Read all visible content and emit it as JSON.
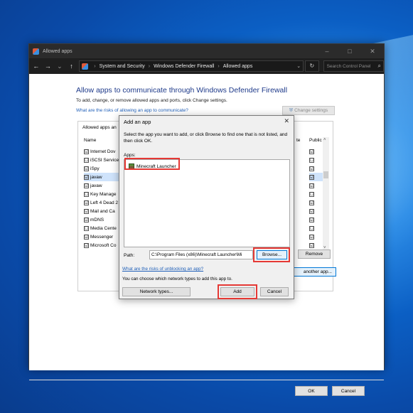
{
  "window": {
    "title": "Allowed apps",
    "controls": {
      "minimize": "–",
      "maximize": "□",
      "close": "✕"
    }
  },
  "navbar": {
    "back": "←",
    "forward": "→",
    "up": "↑",
    "breadcrumb": [
      "System and Security",
      "Windows Defender Firewall",
      "Allowed apps"
    ],
    "breadcrumb_separator": "›",
    "dropdown": "⌄",
    "refresh": "↻",
    "search_placeholder": "Search Control Panel",
    "search_icon": "⌕"
  },
  "main": {
    "heading": "Allow apps to communicate through Windows Defender Firewall",
    "subtext": "To add, change, or remove allowed apps and ports, click Change settings.",
    "risk_link": "What are the risks of allowing an app to communicate?",
    "change_settings": "Change settings",
    "allowed_label": "Allowed apps an",
    "name_header": "Name",
    "private_header": "te",
    "public_header": "Public",
    "apps": [
      {
        "name": "Internet Dov",
        "checked": "☑",
        "public": "☑",
        "selected": false
      },
      {
        "name": "iSCSI Service",
        "checked": "☐",
        "public": "☐",
        "selected": false
      },
      {
        "name": "iSpy",
        "checked": "☑",
        "public": "☑",
        "selected": false
      },
      {
        "name": "javaw",
        "checked": "☑",
        "public": "☑",
        "selected": true
      },
      {
        "name": "javaw",
        "checked": "☑",
        "public": "☑",
        "selected": false
      },
      {
        "name": "Key Manage",
        "checked": "☐",
        "public": "☐",
        "selected": false
      },
      {
        "name": "Left 4 Dead 2",
        "checked": "☑",
        "public": "☑",
        "selected": false
      },
      {
        "name": "Mail and Ca",
        "checked": "☑",
        "public": "☑",
        "selected": false
      },
      {
        "name": "mDNS",
        "checked": "☑",
        "public": "☑",
        "selected": false
      },
      {
        "name": "Media Cente",
        "checked": "☐",
        "public": "☐",
        "selected": false
      },
      {
        "name": "Messenger",
        "checked": "☑",
        "public": "☑",
        "selected": false
      },
      {
        "name": "Microsoft Co",
        "checked": "☑",
        "public": "☑",
        "selected": false
      }
    ],
    "remove_button": "Remove",
    "another_app_button": "another app...",
    "ok_button": "OK",
    "cancel_button": "Cancel"
  },
  "dialog": {
    "title": "Add an app",
    "close": "✕",
    "instructions": "Select the app you want to add, or click Browse to find one that is not listed, and then click OK.",
    "apps_label": "Apps:",
    "selected_app": "Minecraft Launcher",
    "path_label": "Path:",
    "path_value": "C:\\Program Files (x86)\\Minecraft Launcher\\Mi",
    "browse_button": "Browse...",
    "unblock_link": "What are the risks of unblocking an app?",
    "network_text": "You can choose which network types to add this app to.",
    "network_types_button": "Network types...",
    "add_button": "Add",
    "cancel_button": "Cancel"
  },
  "colors": {
    "highlight": "#e53935",
    "link": "#1f5fb8",
    "heading": "#1e3a8a"
  }
}
